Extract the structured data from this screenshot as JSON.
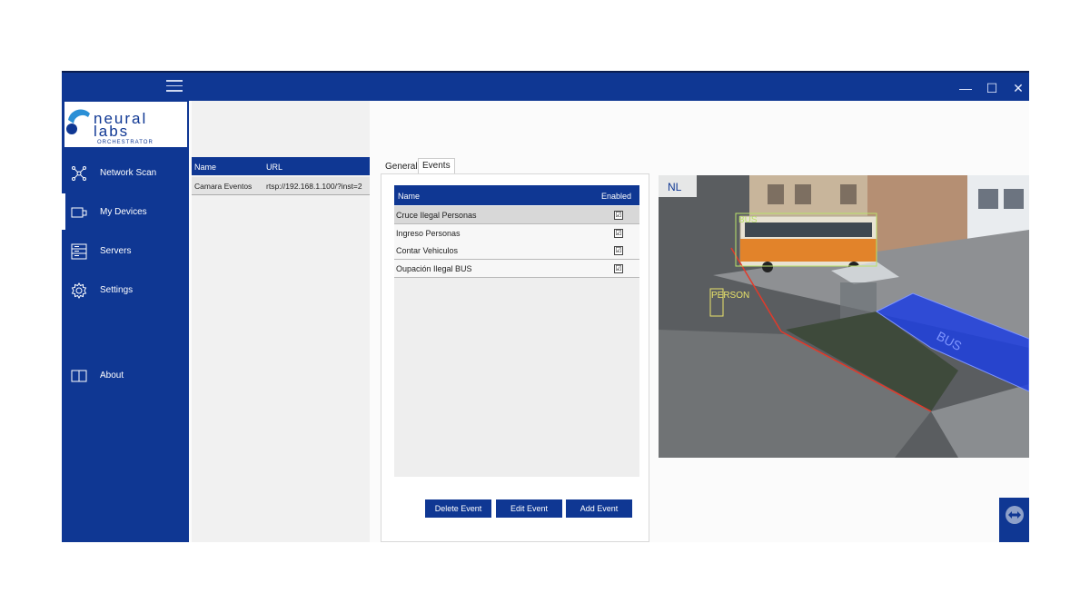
{
  "sidebar": {
    "logo_text": "neural labs",
    "logo_subtitle": "ORCHESTRATOR",
    "items": [
      {
        "label": "Network Scan",
        "icon": "network-icon"
      },
      {
        "label": "My Devices",
        "icon": "devices-icon"
      },
      {
        "label": "Servers",
        "icon": "servers-icon"
      },
      {
        "label": "Settings",
        "icon": "gear-icon"
      },
      {
        "label": "About",
        "icon": "book-icon"
      }
    ]
  },
  "devices": {
    "columns": [
      "Name",
      "URL"
    ],
    "rows": [
      {
        "name": "Camara Eventos",
        "url": "rtsp://192.168.1.100/?inst=2"
      }
    ]
  },
  "tabs": [
    "General",
    "Events"
  ],
  "events": {
    "columns": [
      "Name",
      "Enabled"
    ],
    "rows": [
      {
        "name": "Cruce Ilegal Personas",
        "enabled": "☑"
      },
      {
        "name": "Ingreso Personas",
        "enabled": "☑"
      },
      {
        "name": "Contar Vehiculos",
        "enabled": "☑"
      },
      {
        "name": "Oupación Ilegal BUS",
        "enabled": "☑"
      }
    ]
  },
  "buttons": {
    "delete": "Delete Event",
    "edit": "Edit Event",
    "add": "Add Event"
  },
  "video": {
    "overlay_bus": "BUS",
    "overlay_person": "PERSON",
    "watermark": "NL",
    "zone_label": "BUS"
  },
  "colors": {
    "brand": "#0f3793",
    "zone_blue": "#1f3fe0",
    "line_red": "#e23a2a",
    "overlay_green": "#b9e26a",
    "overlay_yellow": "#e9e36a"
  }
}
